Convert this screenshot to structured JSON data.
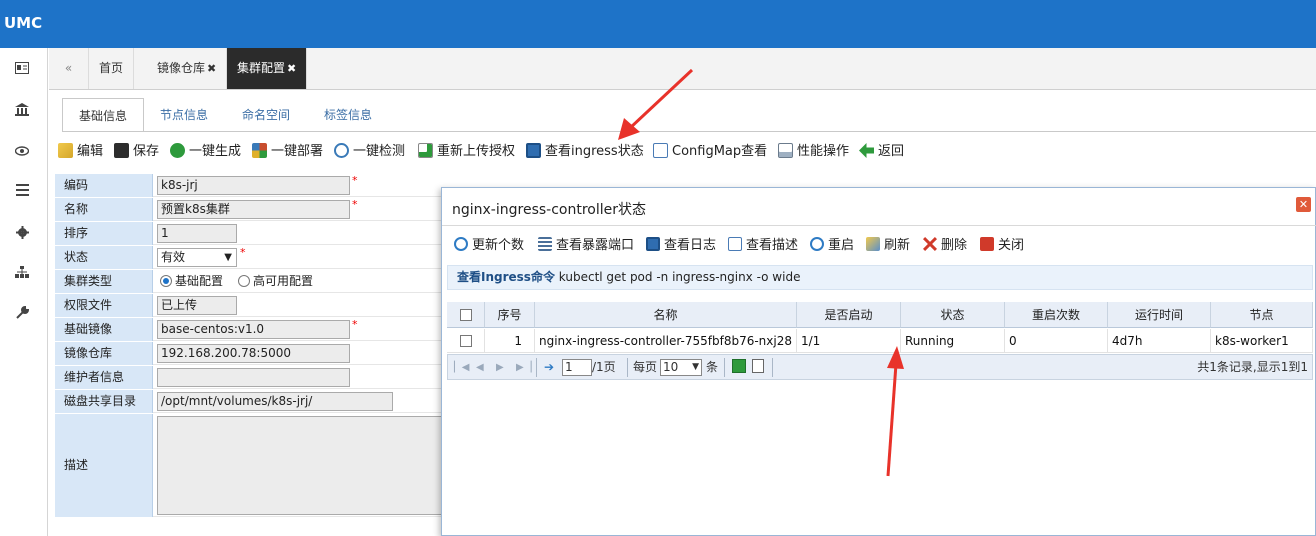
{
  "app": {
    "title": "UMC"
  },
  "leftrail": {
    "icons": [
      "id-card-icon",
      "bank-icon",
      "eye-icon",
      "list-icon",
      "gear-icon",
      "sitemap-icon",
      "wrench-icon"
    ]
  },
  "tabs": [
    {
      "label": "首页",
      "closable": false
    },
    {
      "label": "镜像仓库",
      "closable": true
    },
    {
      "label": "集群配置",
      "closable": true,
      "active": true
    }
  ],
  "tab_close": "✖",
  "subtabs": [
    "基础信息",
    "节点信息",
    "命名空间",
    "标签信息"
  ],
  "toolbar": [
    {
      "label": "编辑",
      "icon": "edit-icon",
      "color": "#d4a62a"
    },
    {
      "label": "保存",
      "icon": "save-icon",
      "color": "#2d2d2d"
    },
    {
      "label": "一键生成",
      "icon": "generate-icon",
      "color": "#2e9a3c"
    },
    {
      "label": "一键部署",
      "icon": "deploy-icon",
      "color": "#c84e2e"
    },
    {
      "label": "一键检测",
      "icon": "search-icon",
      "color": "#3a7ab8"
    },
    {
      "label": "重新上传授权",
      "icon": "upload-icon",
      "color": "#2e9a3c"
    },
    {
      "label": "查看ingress状态",
      "icon": "monitor-icon",
      "color": "#2f6db0"
    },
    {
      "label": "ConfigMap查看",
      "icon": "document-icon",
      "color": "#4a7bb5"
    },
    {
      "label": "性能操作",
      "icon": "chart-icon",
      "color": "#6b7b8c"
    },
    {
      "label": "返回",
      "icon": "back-icon",
      "color": "#2e9a3c"
    }
  ],
  "form": {
    "rows": [
      {
        "label": "编码",
        "value": "k8s-jrj",
        "required": true
      },
      {
        "label": "名称",
        "value": "预置k8s集群",
        "required": true
      },
      {
        "label": "排序",
        "value": "1"
      },
      {
        "label": "状态",
        "value": "有效",
        "required": true,
        "type": "select"
      },
      {
        "label": "集群类型",
        "type": "radio",
        "options": [
          "基础配置",
          "高可用配置"
        ],
        "selected": 0
      },
      {
        "label": "权限文件",
        "value": "已上传"
      },
      {
        "label": "基础镜像",
        "value": "base-centos:v1.0",
        "required": true
      },
      {
        "label": "镜像仓库",
        "value": "192.168.200.78:5000"
      },
      {
        "label": "维护者信息",
        "value": ""
      },
      {
        "label": "磁盘共享目录",
        "value": "/opt/mnt/volumes/k8s-jrj/"
      },
      {
        "label": "描述",
        "value": "",
        "type": "textarea"
      }
    ],
    "required_mark": "*"
  },
  "dialog": {
    "title": "nginx-ingress-controller状态",
    "close": "✕",
    "toolbar": [
      {
        "label": "更新个数",
        "icon": "refresh-count-icon",
        "color": "#2e7bc4"
      },
      {
        "label": "查看暴露端口",
        "icon": "list-icon",
        "color": "#4a6f99"
      },
      {
        "label": "查看日志",
        "icon": "log-icon",
        "color": "#2f6db0"
      },
      {
        "label": "查看描述",
        "icon": "describe-icon",
        "color": "#4a7bb5"
      },
      {
        "label": "重启",
        "icon": "restart-icon",
        "color": "#2e7bc4"
      },
      {
        "label": "刷新",
        "icon": "refresh-icon",
        "color": "#d4a62a"
      },
      {
        "label": "删除",
        "icon": "delete-icon",
        "color": "#d03a2a"
      },
      {
        "label": "关闭",
        "icon": "close-icon",
        "color": "#d03a2a"
      }
    ],
    "command_label": "查看Ingress命令",
    "command": "kubectl get pod -n ingress-nginx -o wide",
    "grid": {
      "columns": [
        "序号",
        "名称",
        "是否启动",
        "状态",
        "重启次数",
        "运行时间",
        "节点"
      ],
      "rows": [
        {
          "index": "1",
          "name": "nginx-ingress-controller-755fbf8b76-nxj28",
          "started": "1/1",
          "status": "Running",
          "restarts": "0",
          "age": "4d7h",
          "node": "k8s-worker1"
        }
      ]
    },
    "pager": {
      "page": "1",
      "total_pages": "/1页",
      "per_page_label": "每页",
      "per_page": "10",
      "per_page_unit": "条",
      "summary": "共1条记录,显示1到1"
    }
  },
  "colors": {
    "topbar": "#1e73c8",
    "arrow": "#e8322a"
  }
}
